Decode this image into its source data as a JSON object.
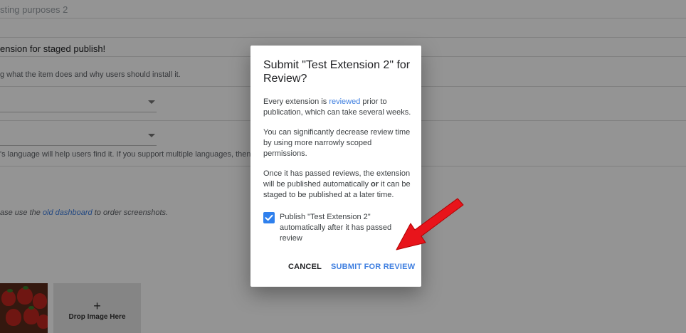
{
  "background": {
    "listing_title": "sting purposes 2",
    "summary_text": "ension for staged publish!",
    "summary_hint": "g what the item does and why users should install it.",
    "language_hint": "'s language will help users find it. If you support multiple languages, then you sl",
    "screenshot_hint_prefix": "ase use the ",
    "screenshot_hint_link": "old dashboard",
    "screenshot_hint_suffix": " to order screenshots.",
    "drop_plus": "+",
    "drop_label": "Drop Image Here"
  },
  "dialog": {
    "title": "Submit \"Test Extension 2\" for Review?",
    "p1_prefix": "Every extension is ",
    "p1_link": "reviewed",
    "p1_suffix": " prior to publication, which can take several weeks.",
    "p2": "You can significantly decrease review time by using more narrowly scoped permissions.",
    "p3_prefix": "Once it has passed reviews, the extension will be published automatically ",
    "p3_bold": "or",
    "p3_suffix": " it can be staged to be published at a later time.",
    "checkbox_checked": true,
    "checkbox_label": "Publish \"Test Extension 2\" automatically after it has passed review",
    "cancel_label": "CANCEL",
    "submit_label": "SUBMIT FOR REVIEW"
  },
  "colors": {
    "accent": "#3f7fe0",
    "checkbox": "#2f80ed",
    "arrow": "#e8141b",
    "overlay": "rgba(0,0,0,0.42)"
  },
  "annotation": {
    "icon": "red-arrow-icon"
  }
}
